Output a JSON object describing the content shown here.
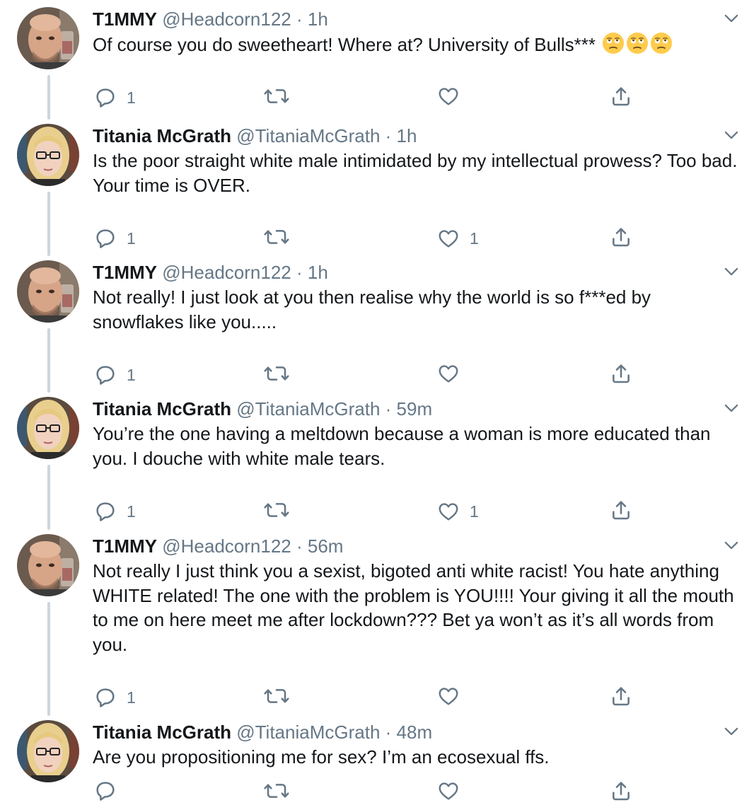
{
  "tweets": [
    {
      "name": "T1MMY",
      "handle": "@Headcorn122",
      "dot": "·",
      "time": "1h",
      "avatar": "timmy",
      "text": "Of course you do sweetheart! Where at? University of Bulls***",
      "emoji": [
        "eye-roll-emoji",
        "eye-roll-emoji",
        "eye-roll-emoji"
      ],
      "replies": "1",
      "retweets": "",
      "likes": ""
    },
    {
      "name": "Titania McGrath",
      "handle": "@TitaniaMcGrath",
      "dot": "·",
      "time": "1h",
      "avatar": "titania",
      "text": "Is the poor straight white male intimidated by my intellectual prowess? Too bad. Your time is OVER.",
      "replies": "1",
      "retweets": "",
      "likes": "1"
    },
    {
      "name": "T1MMY",
      "handle": "@Headcorn122",
      "dot": "·",
      "time": "1h",
      "avatar": "timmy",
      "text": "Not really! I just look at you then realise why the world is so f***ed by snowflakes like you.....",
      "replies": "1",
      "retweets": "",
      "likes": ""
    },
    {
      "name": "Titania McGrath",
      "handle": "@TitaniaMcGrath",
      "dot": "·",
      "time": "59m",
      "avatar": "titania",
      "text": "You’re the one having a meltdown because a woman is more educated than you. I douche with white male tears.",
      "replies": "1",
      "retweets": "",
      "likes": "1"
    },
    {
      "name": "T1MMY",
      "handle": "@Headcorn122",
      "dot": "·",
      "time": "56m",
      "avatar": "timmy",
      "text": "Not really I just think you a sexist, bigoted  anti white racist! You hate anything WHITE related! The one with the problem is YOU!!!! Your giving it all the mouth to me on here meet me after lockdown??? Bet ya won’t as it’s all words from you.",
      "replies": "1",
      "retweets": "",
      "likes": ""
    },
    {
      "name": "Titania McGrath",
      "handle": "@TitaniaMcGrath",
      "dot": "·",
      "time": "48m",
      "avatar": "titania",
      "text": "Are you propositioning me for sex? I’m an ecosexual ffs.",
      "replies": "",
      "retweets": "",
      "likes": ""
    }
  ],
  "icons": {
    "reply": "reply-icon",
    "retweet": "retweet-icon",
    "like": "heart-icon",
    "share": "share-icon",
    "menu": "chevron-down-icon"
  },
  "colors": {
    "text": "#14171a",
    "secondary": "#657786",
    "rail": "#ccd6dd"
  }
}
